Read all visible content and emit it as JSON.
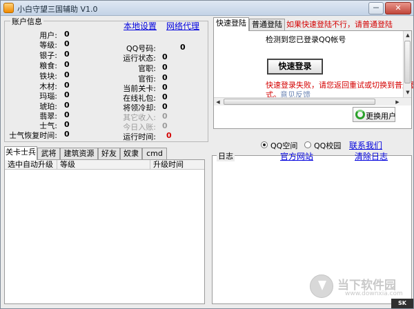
{
  "window": {
    "title": "小白守望三国辅助 V1.0",
    "minimize_label": "－",
    "close_label": "✕"
  },
  "account": {
    "legend": "账户信息",
    "left_fields": [
      {
        "label": "用户:",
        "value": "0"
      },
      {
        "label": "等级:",
        "value": "0"
      },
      {
        "label": "银子:",
        "value": "0"
      },
      {
        "label": "粮食:",
        "value": "0"
      },
      {
        "label": "铁块:",
        "value": "0"
      },
      {
        "label": "木材:",
        "value": "0"
      },
      {
        "label": "玛瑙:",
        "value": "0"
      },
      {
        "label": "琥珀:",
        "value": "0"
      },
      {
        "label": "翡翠:",
        "value": "0"
      },
      {
        "label": "士气:",
        "value": "0"
      },
      {
        "label": "士气恢复时间:",
        "value": "0"
      }
    ],
    "right_fields": [
      {
        "label": "QQ号码:",
        "value": "0",
        "disabled": false
      },
      {
        "label": "运行状态:",
        "value": "0",
        "disabled": false
      },
      {
        "label": "官职:",
        "value": "0",
        "disabled": false
      },
      {
        "label": "官衔:",
        "value": "0",
        "disabled": false
      },
      {
        "label": "当前关卡:",
        "value": "0",
        "disabled": false
      },
      {
        "label": "在线礼包:",
        "value": "0",
        "disabled": false
      },
      {
        "label": "将领冷却:",
        "value": "0",
        "disabled": false
      },
      {
        "label": "其它收入:",
        "value": "0",
        "disabled": true
      },
      {
        "label": "今日入账:",
        "value": "0",
        "disabled": true
      },
      {
        "label": "运行时间:",
        "value": "0",
        "disabled": false
      }
    ],
    "local_settings_link": "本地设置",
    "proxy_link": "网络代理"
  },
  "bottom_tabs": [
    "关卡士兵",
    "武将",
    "建筑资源",
    "好友",
    "奴隶",
    "cmd"
  ],
  "upgrade_table": {
    "columns": [
      "选中自动升级",
      "等级",
      "升级时间"
    ]
  },
  "login": {
    "tabs": [
      "快速登陆",
      "普通登陆"
    ],
    "hint": "如果快速登陆不行，请普通登陆",
    "detected_text": "检测到您已登录QQ帐号",
    "quick_login_button": "快速登录",
    "error_text": "快速登录失败，请您返回重试或切换到普通登陆方",
    "error_text_2": "式。",
    "feedback_link": "意见反馈",
    "switch_user_button": "更换用户"
  },
  "login_type": {
    "options": [
      "QQ空间",
      "QQ校园"
    ],
    "selected": "QQ空间",
    "contact_link": "联系我们"
  },
  "log": {
    "legend": "日志",
    "website_link": "官方网站",
    "clear_link": "清除日志"
  },
  "colors": {
    "link": "#0000dd",
    "warning": "#d40000",
    "disabled": "#9c9c9c"
  },
  "watermark": {
    "name": "当下软件园",
    "url": "www.downxia.com"
  },
  "grip_text": "SK"
}
